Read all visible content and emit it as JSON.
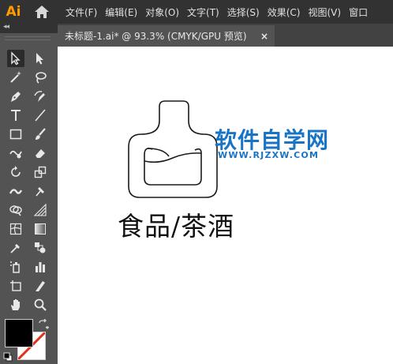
{
  "app": {
    "logo_text": "Ai",
    "accent": "#ff9a00"
  },
  "menu": {
    "items": [
      "文件(F)",
      "编辑(E)",
      "对象(O)",
      "文字(T)",
      "选择(S)",
      "效果(C)",
      "视图(V)",
      "窗口"
    ]
  },
  "panel": {
    "collapse_label": "◂◂"
  },
  "document": {
    "tab_label": "未标题-1.ai* @ 93.3% (CMYK/GPU 预览)",
    "close_label": "×"
  },
  "artwork": {
    "caption": "食品/茶酒"
  },
  "watermark": {
    "title": "软件自学网",
    "url": "WWW.RJZXW.COM",
    "color": "#1a74c6"
  },
  "colors": {
    "fill": "#000000",
    "stroke": "none"
  },
  "tools": [
    "selection-tool",
    "direct-selection-tool",
    "magic-wand-tool",
    "lasso-tool",
    "pen-tool",
    "curvature-tool",
    "type-tool",
    "line-segment-tool",
    "rectangle-tool",
    "paintbrush-tool",
    "shaper-tool",
    "eraser-tool",
    "rotate-tool",
    "scale-tool",
    "width-tool",
    "puppet-warp-tool",
    "shape-builder-tool",
    "perspective-grid-tool",
    "mesh-tool",
    "gradient-tool",
    "eyedropper-tool",
    "blend-tool",
    "symbol-sprayer-tool",
    "column-graph-tool",
    "artboard-tool",
    "slice-tool",
    "hand-tool",
    "zoom-tool"
  ]
}
